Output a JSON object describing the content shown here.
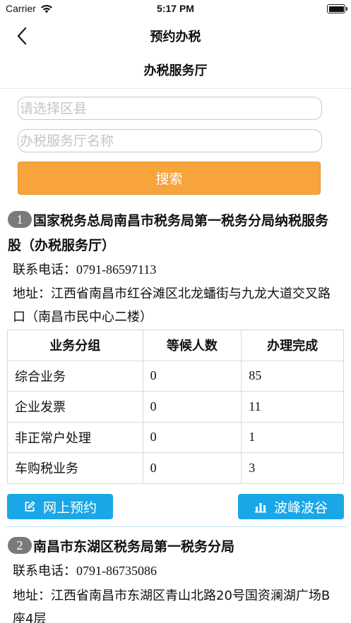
{
  "status_bar": {
    "carrier": "Carrier",
    "time": "5:17 PM"
  },
  "nav": {
    "title": "预约办税"
  },
  "section": {
    "title": "办税服务厅"
  },
  "filters": {
    "district_placeholder": "请选择区县",
    "hall_name_placeholder": "办税服务厅名称",
    "search_label": "搜索"
  },
  "halls": [
    {
      "index": "1",
      "name": "国家税务总局南昌市税务局第一税务分局纳税服务股（办税服务厅）",
      "phone_label": "联系电话：",
      "phone": "0791-86597113",
      "address_label": "地址：",
      "address": "江西省南昌市红谷滩区北龙蟠街与九龙大道交叉路口（南昌市民中心二楼）",
      "table": {
        "headers": [
          "业务分组",
          "等候人数",
          "办理完成"
        ],
        "rows": [
          {
            "group": "综合业务",
            "waiting": "0",
            "done": "85"
          },
          {
            "group": "企业发票",
            "waiting": "0",
            "done": "11"
          },
          {
            "group": "非正常户处理",
            "waiting": "0",
            "done": "1"
          },
          {
            "group": "车购税业务",
            "waiting": "0",
            "done": "3"
          }
        ]
      },
      "online_booking_label": "网上预约",
      "peak_label": "波峰波谷"
    },
    {
      "index": "2",
      "name": "南昌市东湖区税务局第一税务分局",
      "phone_label": "联系电话：",
      "phone": "0791-86735086",
      "address_label": "地址：",
      "address": "江西省南昌市东湖区青山北路20号国资澜湖广场B座4层"
    }
  ],
  "colors": {
    "accent_orange": "#f7a43c",
    "accent_blue": "#1aa7e8",
    "badge_gray": "#7a7a7a"
  },
  "icons": [
    "wifi-icon",
    "battery-icon",
    "back-chevron-icon",
    "edit-icon",
    "bar-chart-icon"
  ]
}
